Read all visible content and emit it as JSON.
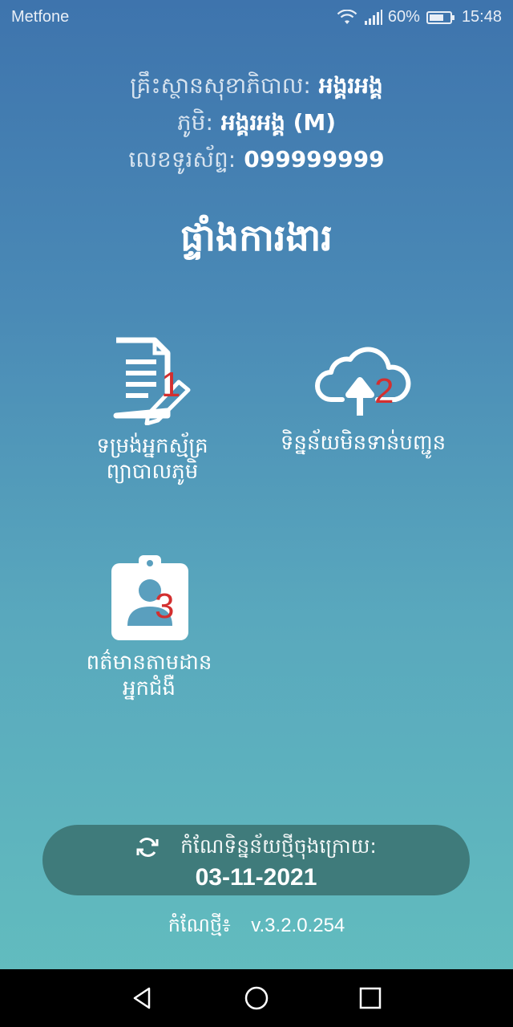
{
  "status_bar": {
    "carrier": "Metfone",
    "battery_percent": "60%",
    "time": "15:48"
  },
  "info": {
    "facility_label": "គ្រឹះស្ថានសុខាភិបាល:",
    "facility_value": "អង្គរអង្គ",
    "village_label": "ភូមិ:",
    "village_value": "អង្គរអង្គ (M)",
    "phone_label": "លេខទូរស័ព្ទ:",
    "phone_value": "099999999"
  },
  "dashboard_title": "ផ្ទាំងការងារ",
  "menu": {
    "tile1": {
      "label_line1": "ទម្រង់អ្នកស្ម័គ្រ",
      "label_line2": "ព្យាបាលភូមិ",
      "badge_number": "1",
      "icon": "form-edit-icon"
    },
    "tile2": {
      "label_line1": "ទិន្នន័យមិនទាន់បញ្ជូន",
      "badge_number": "2",
      "icon": "cloud-upload-icon"
    },
    "tile3": {
      "label_line1": "ពត៌មានតាមដាន",
      "label_line2": "អ្នកជំងឺ",
      "badge_number": "3",
      "icon": "patient-badge-icon"
    }
  },
  "sync": {
    "label": "កំណែទិន្នន័យថ្មីចុងក្រោយ:",
    "date": "03-11-2021",
    "icon": "sync-icon"
  },
  "version": {
    "label": "កំណែថ្មី៖",
    "value": "v.3.2.0.254"
  },
  "colors": {
    "accent_red": "#d32f2f",
    "pill_bg": "#3f7b7b"
  }
}
